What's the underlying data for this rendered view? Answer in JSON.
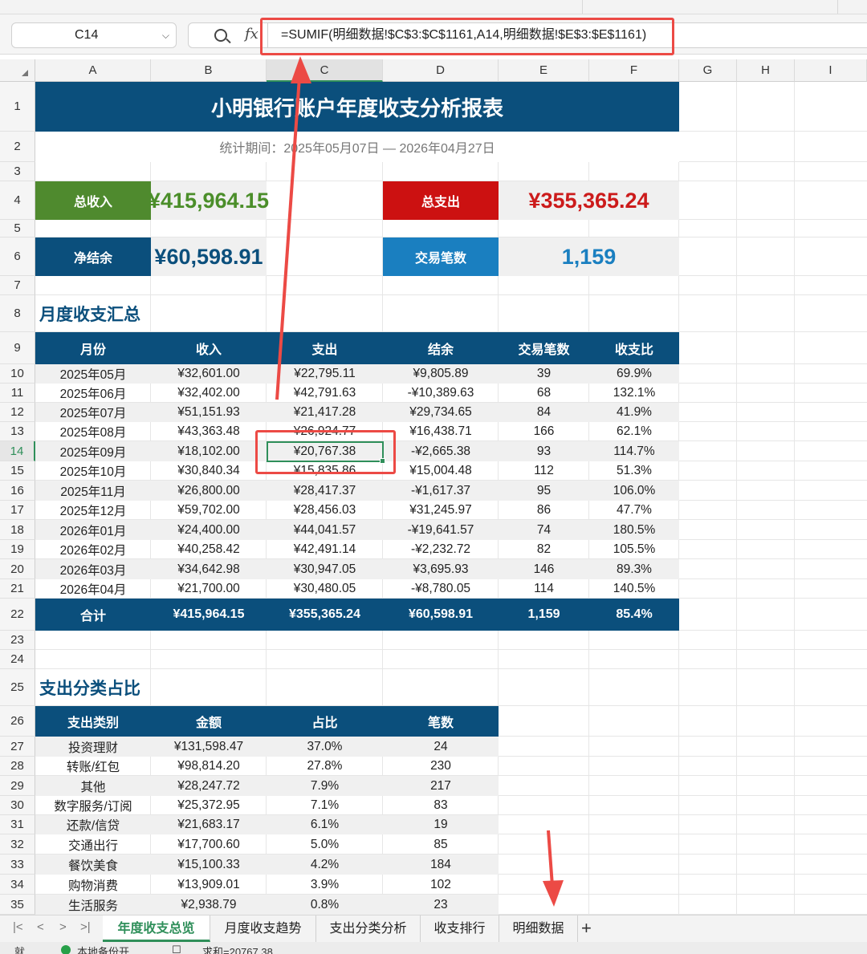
{
  "formula_bar": {
    "name_box": "C14",
    "formula": "=SUMIF(明细数据!$C$3:$C$1161,A14,明细数据!$E$3:$E$1161)",
    "zoom_icon": "magnifier-icon",
    "fx_label": "fx"
  },
  "columns": [
    "A",
    "B",
    "C",
    "D",
    "E",
    "F",
    "G",
    "H",
    "I"
  ],
  "rows": [
    "1",
    "2",
    "3",
    "4",
    "5",
    "6",
    "7",
    "8",
    "9",
    "10",
    "11",
    "12",
    "13",
    "14",
    "15",
    "16",
    "17",
    "18",
    "19",
    "20",
    "21",
    "22",
    "23",
    "24",
    "25",
    "26",
    "27",
    "28",
    "29",
    "30",
    "31",
    "32",
    "33",
    "34",
    "35"
  ],
  "report": {
    "title": "小明银行账户年度收支分析报表",
    "period": "统计期间：2025年05月07日 — 2026年04月27日"
  },
  "kpis": {
    "income": {
      "label": "总收入",
      "value": "¥415,964.15",
      "label_bg": "#4f8a2e",
      "value_color": "#4b8e2a"
    },
    "expense": {
      "label": "总支出",
      "value": "¥355,365.24",
      "label_bg": "#cc1111",
      "value_color": "#cc1b1b"
    },
    "net": {
      "label": "净结余",
      "value": "¥60,598.91",
      "label_bg": "#0b4f7c",
      "value_color": "#0b4f7c"
    },
    "count": {
      "label": "交易笔数",
      "value": "1,159",
      "label_bg": "#1a7fc0",
      "value_color": "#1a7fc0"
    }
  },
  "monthly": {
    "section_title": "月度收支汇总",
    "headers": [
      "月份",
      "收入",
      "支出",
      "结余",
      "交易笔数",
      "收支比"
    ],
    "rows": [
      [
        "2025年05月",
        "¥32,601.00",
        "¥22,795.11",
        "¥9,805.89",
        "39",
        "69.9%"
      ],
      [
        "2025年06月",
        "¥32,402.00",
        "¥42,791.63",
        "-¥10,389.63",
        "68",
        "132.1%"
      ],
      [
        "2025年07月",
        "¥51,151.93",
        "¥21,417.28",
        "¥29,734.65",
        "84",
        "41.9%"
      ],
      [
        "2025年08月",
        "¥43,363.48",
        "¥26,924.77",
        "¥16,438.71",
        "166",
        "62.1%"
      ],
      [
        "2025年09月",
        "¥18,102.00",
        "¥20,767.38",
        "-¥2,665.38",
        "93",
        "114.7%"
      ],
      [
        "2025年10月",
        "¥30,840.34",
        "¥15,835.86",
        "¥15,004.48",
        "112",
        "51.3%"
      ],
      [
        "2025年11月",
        "¥26,800.00",
        "¥28,417.37",
        "-¥1,617.37",
        "95",
        "106.0%"
      ],
      [
        "2025年12月",
        "¥59,702.00",
        "¥28,456.03",
        "¥31,245.97",
        "86",
        "47.7%"
      ],
      [
        "2026年01月",
        "¥24,400.00",
        "¥44,041.57",
        "-¥19,641.57",
        "74",
        "180.5%"
      ],
      [
        "2026年02月",
        "¥40,258.42",
        "¥42,491.14",
        "-¥2,232.72",
        "82",
        "105.5%"
      ],
      [
        "2026年03月",
        "¥34,642.98",
        "¥30,947.05",
        "¥3,695.93",
        "146",
        "89.3%"
      ],
      [
        "2026年04月",
        "¥21,700.00",
        "¥30,480.05",
        "-¥8,780.05",
        "114",
        "140.5%"
      ]
    ],
    "total": [
      "合计",
      "¥415,964.15",
      "¥355,365.24",
      "¥60,598.91",
      "1,159",
      "85.4%"
    ]
  },
  "category": {
    "section_title": "支出分类占比",
    "headers": [
      "支出类别",
      "金额",
      "占比",
      "笔数"
    ],
    "rows": [
      [
        "投资理财",
        "¥131,598.47",
        "37.0%",
        "24"
      ],
      [
        "转账/红包",
        "¥98,814.20",
        "27.8%",
        "230"
      ],
      [
        "其他",
        "¥28,247.72",
        "7.9%",
        "217"
      ],
      [
        "数字服务/订阅",
        "¥25,372.95",
        "7.1%",
        "83"
      ],
      [
        "还款/信贷",
        "¥21,683.17",
        "6.1%",
        "19"
      ],
      [
        "交通出行",
        "¥17,700.60",
        "5.0%",
        "85"
      ],
      [
        "餐饮美食",
        "¥15,100.33",
        "4.2%",
        "184"
      ],
      [
        "购物消费",
        "¥13,909.01",
        "3.9%",
        "102"
      ],
      [
        "生活服务",
        "¥2,938.79",
        "0.8%",
        "23"
      ]
    ]
  },
  "sheet_tabs": [
    "年度收支总览",
    "月度收支趋势",
    "支出分类分析",
    "收支排行",
    "明细数据"
  ],
  "tab_nav": [
    "|<",
    "<",
    ">",
    ">|"
  ],
  "add_tab": "+",
  "statusbar": {
    "left": "就",
    "sync": "本地备份开",
    "sum": "求和=20767.38"
  },
  "colors": {
    "header_blue": "#0b4f7c",
    "annotation_red": "#ec4a45",
    "selection_green": "#2f8f5a"
  }
}
